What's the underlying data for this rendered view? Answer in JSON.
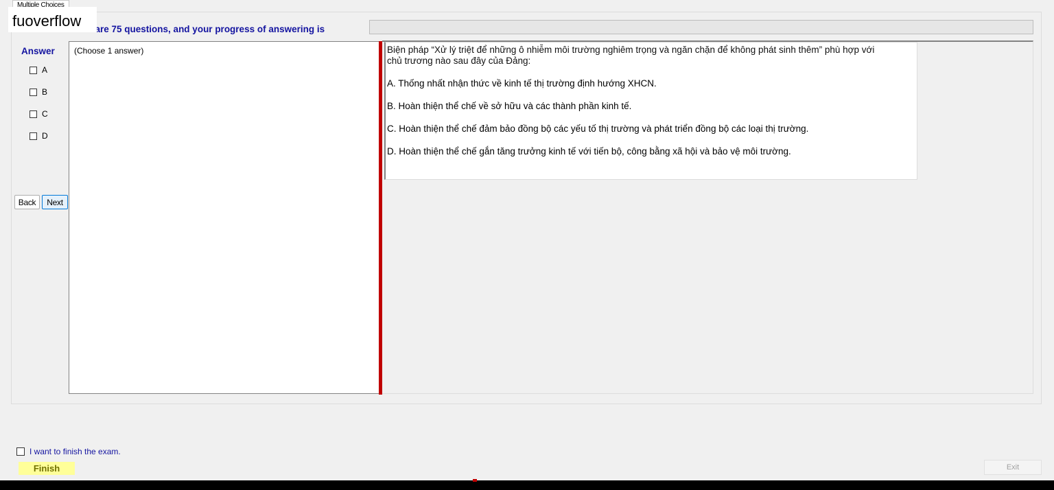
{
  "tab": {
    "label": "Multiple Choices"
  },
  "watermark": "fuoverflow",
  "progress": {
    "text": "There are 75 questions, and your progress of answering is",
    "fraction": 0
  },
  "answer_panel": {
    "title": "Answer",
    "options": [
      "A",
      "B",
      "C",
      "D"
    ]
  },
  "nav": {
    "back_label": "Back",
    "next_label": "Next"
  },
  "left_pane": {
    "hint": "(Choose 1 answer)"
  },
  "question": {
    "stem": "Biện pháp “Xử lý triệt để những ô nhiễm môi trường nghiêm trọng và ngăn chặn để không phát sinh thêm” phù hợp với chủ trương nào sau đây của Đảng:",
    "options": [
      "A.  Thống nhất nhận thức về kinh tế thị trường định hướng XHCN.",
      "B.  Hoàn thiện thể chế về sở hữu và các thành phần kinh tế.",
      "C.  Hoàn thiện thể chế đảm bảo đồng bộ các yếu tố thị trường và phát triển đồng bộ các loại thị trường.",
      "D.  Hoàn thiện thể chế gắn tăng trưởng kinh tế với tiến bộ, công bằng xã hội và bảo vệ môi trường."
    ]
  },
  "footer": {
    "finish_check_label": "I want to finish the exam.",
    "finish_label": "Finish",
    "exit_label": "Exit"
  },
  "colors": {
    "accent_text": "#1414a0",
    "splitter": "#c00000",
    "finish_bg": "#ffff99",
    "next_border": "#0078d7"
  }
}
